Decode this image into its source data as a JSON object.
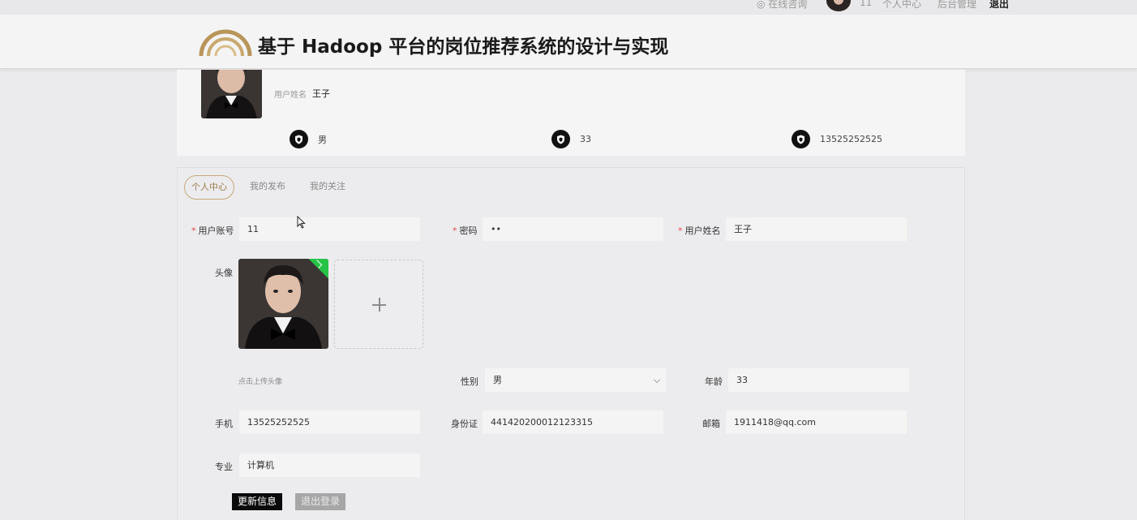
{
  "topbar": {
    "online_consult": "在线咨询",
    "username": "11",
    "personal_center": "个人中心",
    "admin": "后台管理",
    "logout": "退出"
  },
  "header": {
    "title": "基于 Hadoop 平台的岗位推荐系统的设计与实现"
  },
  "profile": {
    "name_label": "用户姓名",
    "name_value": "王子",
    "gender": "男",
    "age": "33",
    "phone": "13525252525"
  },
  "tabs": [
    {
      "label": "个人中心",
      "active": true
    },
    {
      "label": "我的发布",
      "active": false
    },
    {
      "label": "我的关注",
      "active": false
    }
  ],
  "form": {
    "account_label": "用户账号",
    "account_value": "11",
    "password_label": "密码",
    "password_value": "••",
    "name_label": "用户姓名",
    "name_value": "王子",
    "avatar_label": "头像",
    "upload_tip": "点击上传头像",
    "gender_label": "性别",
    "gender_value": "男",
    "age_label": "年龄",
    "age_value": "33",
    "phone_label": "手机",
    "phone_value": "13525252525",
    "idcard_label": "身份证",
    "idcard_value": "441420200012123315",
    "email_label": "邮箱",
    "email_value": "1911418@qq.com",
    "major_label": "专业",
    "major_value": "计算机"
  },
  "buttons": {
    "update": "更新信息",
    "logout": "退出登录"
  },
  "colors": {
    "accent_gold": "#c8a97a",
    "required_red": "#e04a4a",
    "success_green": "#27c346",
    "primary_black": "#0a0a0a"
  }
}
